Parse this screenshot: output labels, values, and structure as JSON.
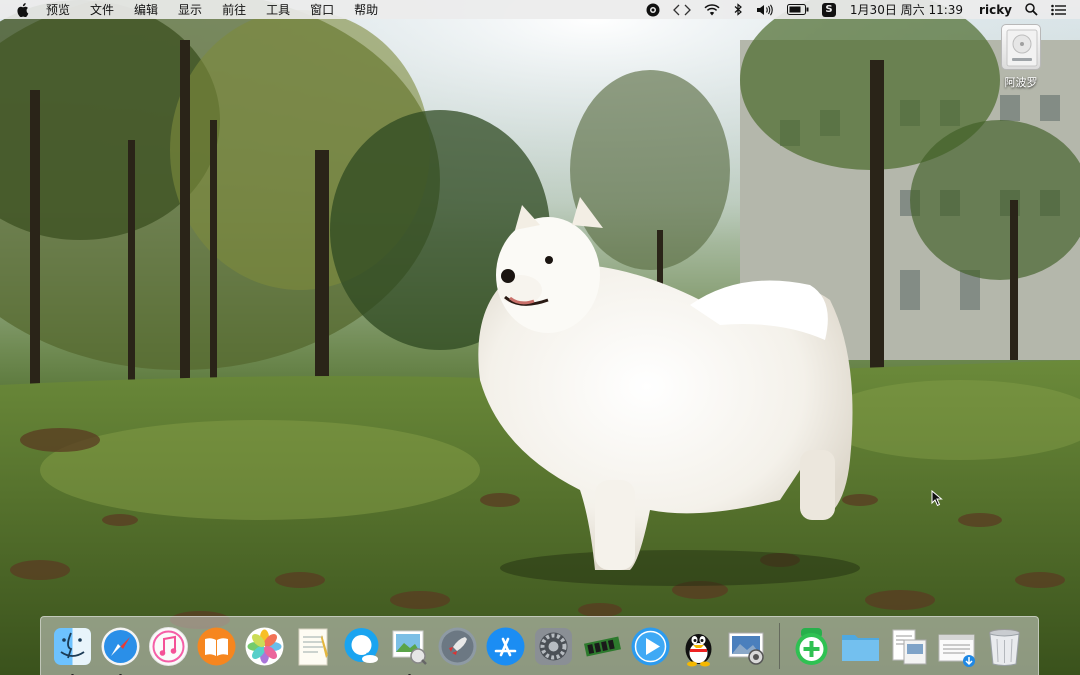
{
  "menubar": {
    "apple_icon": "apple-logo-icon",
    "menus": [
      "预览",
      "文件",
      "编辑",
      "显示",
      "前往",
      "工具",
      "窗口",
      "帮助"
    ],
    "status_icons": [
      "app-circle-icon",
      "code-brackets-icon",
      "wifi-icon",
      "bluetooth-icon",
      "volume-icon",
      "battery-icon",
      "s-app-icon"
    ],
    "s_badge": "S",
    "clock": "1月30日 周六  11:39",
    "user": "ricky",
    "right_icons": [
      "search-icon",
      "list-icon"
    ]
  },
  "desktop": {
    "drive_label": "阿波罗",
    "wallpaper": "white samoyed dog standing in grassy park with trees and fallen leaves"
  },
  "dock": {
    "apps": [
      {
        "name": "finder",
        "running": true
      },
      {
        "name": "safari",
        "running": true
      },
      {
        "name": "itunes",
        "running": false
      },
      {
        "name": "ibooks",
        "running": false
      },
      {
        "name": "photos",
        "running": false
      },
      {
        "name": "textedit",
        "running": false
      },
      {
        "name": "qq-browser",
        "running": false
      },
      {
        "name": "preview",
        "running": true
      },
      {
        "name": "launchpad",
        "running": false
      },
      {
        "name": "app-store",
        "running": false
      },
      {
        "name": "system-preferences",
        "running": false
      },
      {
        "name": "memory-cleaner",
        "running": false
      },
      {
        "name": "quicktime",
        "running": false
      },
      {
        "name": "qq",
        "running": false
      },
      {
        "name": "image-capture",
        "running": false
      },
      {
        "name": "add-app",
        "running": false
      },
      {
        "name": "folder",
        "running": false
      },
      {
        "name": "pages-doc",
        "running": false
      },
      {
        "name": "downloads",
        "running": false
      },
      {
        "name": "trash",
        "running": false
      }
    ]
  },
  "colors": {
    "menubar_bg": "#ececec",
    "dock_bg": "#d2d2d2",
    "accent_blue": "#1e88e5",
    "grass": "#4f6e2e"
  }
}
